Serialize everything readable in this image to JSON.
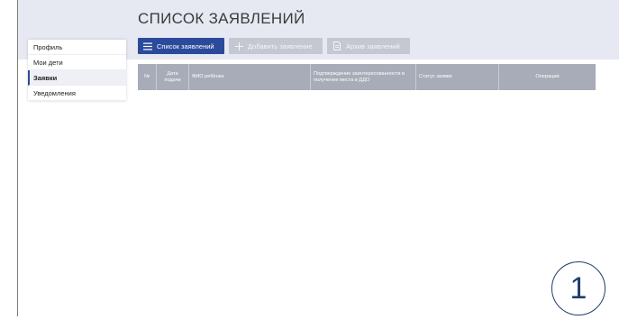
{
  "page": {
    "title": "СПИСОК ЗАЯВЛЕНИЙ"
  },
  "tabs": [
    {
      "label": "Список заявлений",
      "icon": "list-icon",
      "active": true
    },
    {
      "label": "Добавить заявление",
      "icon": "plus-icon",
      "active": false
    },
    {
      "label": "Архив заявлений",
      "icon": "document-icon",
      "active": false
    }
  ],
  "sidebar": {
    "items": [
      {
        "label": "Профиль",
        "active": false
      },
      {
        "label": "Мои дети",
        "active": false
      },
      {
        "label": "Заявки",
        "active": true
      },
      {
        "label": "Уведомления",
        "active": false
      }
    ]
  },
  "table": {
    "columns": [
      "№",
      "Дата подачи",
      "ФИО ребёнка",
      "Подтверждение заинтересованности в получение места в ДДО",
      "Статус заявки",
      "Операции"
    ]
  },
  "step_badge": "1",
  "colors": {
    "accent": "#2c4a9c",
    "tab_inactive": "#c5c8d3",
    "header_band": "#e6e8f2",
    "table_header": "#a8acb8",
    "badge": "#1f3e6e"
  }
}
